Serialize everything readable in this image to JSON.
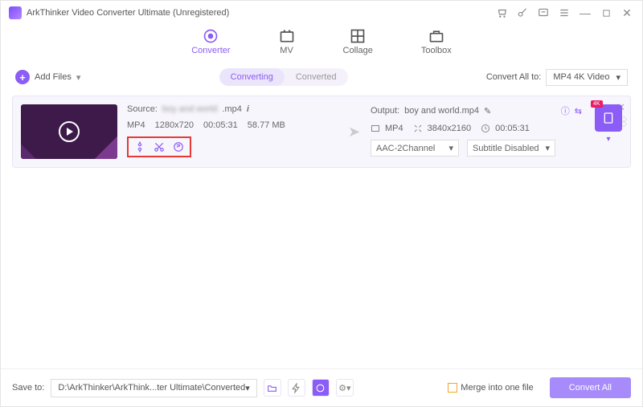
{
  "window": {
    "title": "ArkThinker Video Converter Ultimate (Unregistered)"
  },
  "tabs": {
    "converter": "Converter",
    "mv": "MV",
    "collage": "Collage",
    "toolbox": "Toolbox"
  },
  "toolbar": {
    "add_files": "Add Files",
    "converting": "Converting",
    "converted": "Converted",
    "convert_all_to": "Convert All to:",
    "format_selected": "MP4 4K Video"
  },
  "item": {
    "source_label": "Source:",
    "source_name": "boy and world",
    "source_ext": ".mp4",
    "format": "MP4",
    "resolution": "1280x720",
    "duration": "00:05:31",
    "size": "58.77 MB",
    "output_label": "Output:",
    "output_name": "boy and world.mp4",
    "out_format": "MP4",
    "out_resolution": "3840x2160",
    "out_duration": "00:05:31",
    "audio_select": "AAC-2Channel",
    "subtitle_select": "Subtitle Disabled"
  },
  "footer": {
    "save_to": "Save to:",
    "path": "D:\\ArkThinker\\ArkThink...ter Ultimate\\Converted",
    "merge": "Merge into one file",
    "convert_all": "Convert All"
  }
}
